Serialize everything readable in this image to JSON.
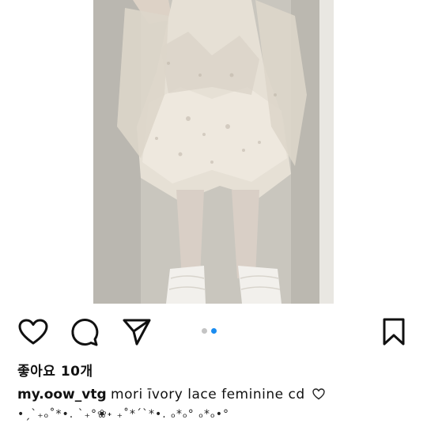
{
  "post": {
    "likes_text": "좋아요 10개",
    "username": "my.oow_vtg",
    "caption": "mori īvory lace feminine cd",
    "decoration": "•ˏˋ₊ₒ˚*•. ˋ₊°❀˖ ₊˚*´`*•. ₒ*ₒ° ₒ*ₒ•°"
  },
  "carousel": {
    "total": 2,
    "active": 2
  },
  "actions": {
    "like_icon": "heart-icon",
    "comment_icon": "comment-bubble-icon",
    "share_icon": "paper-plane-icon",
    "save_icon": "bookmark-icon"
  },
  "colors": {
    "dot_active": "#1a8cf0",
    "dot_inactive": "#c4c4c4",
    "text": "#111111"
  }
}
